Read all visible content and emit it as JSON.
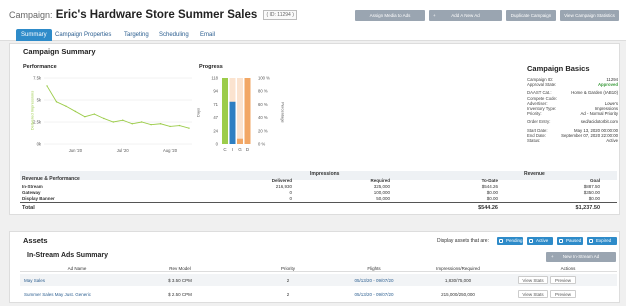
{
  "header": {
    "label": "Campaign:",
    "name": "Eric's Hardware Store Summer Sales",
    "campaign_id_tag": "( ID: 11294 )",
    "buttons": [
      "Assign Media to Ads",
      "Add A New Ad",
      "Duplicate Campaign",
      "View Campaign Statistics"
    ]
  },
  "tabs": [
    "Summary",
    "Campaign Properties",
    "Targeting",
    "Scheduling",
    "Email"
  ],
  "summary": {
    "title": "Campaign Summary",
    "performance": {
      "title": "Performance",
      "ylabel": "Delivered Impressions",
      "yticks": [
        "7.5k",
        "5k",
        "2.5k",
        "0k"
      ],
      "xticks": [
        "Jun '20",
        "Jul '20",
        "Aug '20"
      ]
    },
    "progress": {
      "title": "Progress",
      "ylabel": "Days",
      "y2label": "Percentage",
      "yticks": [
        "118",
        "94",
        "71",
        "47",
        "24",
        "0"
      ],
      "y2ticks": [
        "100 %",
        "80 %",
        "60 %",
        "40 %",
        "20 %",
        "0 %"
      ],
      "xticks": [
        "C",
        "I",
        "G",
        "D"
      ]
    },
    "basics": {
      "title": "Campaign Basics",
      "rows1": [
        [
          "Campaign ID:",
          "11294"
        ],
        [
          "Approval State:",
          "Approved"
        ]
      ],
      "rows2": [
        [
          "DAAST Cat.:",
          "Home & Garden (IAB10)"
        ],
        [
          "Compete Code:",
          ""
        ],
        [
          "Advertiser:",
          "Lowe's"
        ],
        [
          "Inventory Type:",
          "Impressions"
        ],
        [
          "Priority:",
          "Ad - Normal Priority"
        ]
      ],
      "rows3": [
        [
          "Order Entry:",
          "sed/acidotorbit.com"
        ]
      ],
      "rows4": [
        [
          "Start Date:",
          "May 13, 2020 00:00:00"
        ],
        [
          "End Date:",
          "September 07, 2020 22:00:00"
        ],
        [
          "Status:",
          "Active"
        ]
      ]
    }
  },
  "chart_data": [
    {
      "type": "line",
      "title": "Performance",
      "xlabel": "",
      "ylabel": "Delivered Impressions",
      "ylim": [
        0,
        7500
      ],
      "x": [
        "May 13",
        "May 20",
        "May 27",
        "Jun 3",
        "Jun 10",
        "Jun 17",
        "Jun 24",
        "Jul 1",
        "Jul 8",
        "Jul 15",
        "Jul 22",
        "Jul 29",
        "Aug 5",
        "Aug 12",
        "Aug 19",
        "Aug 26"
      ],
      "series": [
        {
          "values": [
            6600,
            4800,
            4300,
            3700,
            3100,
            3400,
            2900,
            2500,
            2700,
            2300,
            2500,
            2200,
            2300,
            2000,
            2100,
            1800
          ]
        }
      ],
      "xticks": [
        "Jun '20",
        "Jul '20",
        "Aug '20"
      ],
      "grid": true
    },
    {
      "type": "bar",
      "title": "Progress",
      "categories": [
        "C",
        "I",
        "G",
        "D"
      ],
      "values_percent": [
        100,
        64,
        8,
        100
      ],
      "colors": [
        "#9ccc4a",
        "#2e7fc2",
        "#f2a765",
        "#f2a765"
      ],
      "ylabel": "Days",
      "y2label": "Percentage",
      "ylim": [
        0,
        118
      ],
      "y2lim": [
        0,
        100
      ]
    }
  ],
  "revenue_table": {
    "headers": {
      "col1": "Revenue & Performance",
      "group_impressions": "Impressions",
      "group_revenue": "Revenue",
      "delivered": "Delivered",
      "required": "Required",
      "todate": "To-Date",
      "goal": "Goal"
    },
    "rows": [
      {
        "name": "In-Stream",
        "delivered": "216,930",
        "required": "325,000",
        "todate": "$544.26",
        "goal": "$887.50"
      },
      {
        "name": "Gateway",
        "delivered": "0",
        "required": "100,000",
        "todate": "$0.00",
        "goal": "$350.00"
      },
      {
        "name": "Display Banner",
        "delivered": "0",
        "required": "50,000",
        "todate": "$0.00",
        "goal": "$0.00"
      }
    ],
    "total": {
      "name": "Total",
      "todate": "$544.26",
      "goal": "$1,237.50"
    }
  },
  "assets": {
    "title": "Assets",
    "filter_label": "Display assets that are:",
    "filters": [
      "Pending",
      "Active",
      "Paused",
      "Expired"
    ],
    "instream_title": "In-Stream Ads Summary",
    "new_button": "New In-Stream Ad",
    "columns": [
      "Ad Name",
      "Rev Model",
      "Priority",
      "Flights",
      "Impressions/Required",
      "Actions"
    ],
    "rows": [
      {
        "name": "May Sales",
        "rev": "$ 3.50 CPM",
        "priority": "2",
        "flights": "05/13/20 - 09/07/20",
        "impr": "1,830/75,000",
        "stats": "View Stats",
        "preview": "Preview"
      },
      {
        "name": "Summer Sales May Just. Generic",
        "rev": "$ 2.50 CPM",
        "priority": "2",
        "flights": "05/13/20 - 09/07/20",
        "impr": "215,000/250,000",
        "stats": "View Stats",
        "preview": "Preview"
      }
    ]
  },
  "colors": {
    "accent": "#2e8bc9",
    "approved": "#3a9a3a",
    "header_button": "#9aa5b1"
  }
}
